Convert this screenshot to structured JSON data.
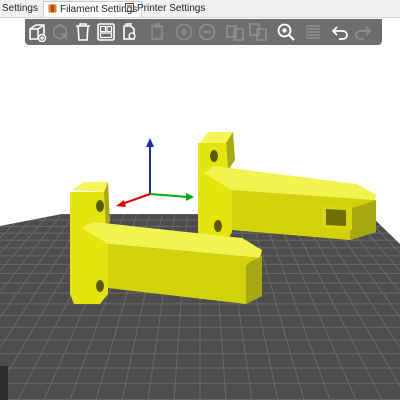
{
  "tabs": [
    {
      "label": "Print Settings",
      "icon": "gear-icon"
    },
    {
      "label": "Filament Settings",
      "icon": "filament-spool-icon"
    },
    {
      "label": "Printer Settings",
      "icon": "printer-icon"
    }
  ],
  "toolbar": {
    "buttons": [
      {
        "name": "add-object",
        "icon": "add-cube-icon",
        "enabled": true
      },
      {
        "name": "delete",
        "icon": "delete-icon",
        "enabled": false
      },
      {
        "name": "delete-all",
        "icon": "trash-icon",
        "enabled": true
      },
      {
        "name": "arrange",
        "icon": "arrange-icon",
        "enabled": true
      },
      {
        "name": "copy",
        "icon": "copy-icon",
        "enabled": true
      },
      {
        "name": "paste",
        "icon": "paste-icon",
        "enabled": false
      },
      {
        "name": "add-instance",
        "icon": "plus-circle-icon",
        "enabled": false
      },
      {
        "name": "remove-instance",
        "icon": "minus-circle-icon",
        "enabled": false
      },
      {
        "name": "split-objects",
        "icon": "split-objects-icon",
        "enabled": false
      },
      {
        "name": "split-parts",
        "icon": "split-parts-icon",
        "enabled": false
      },
      {
        "name": "search",
        "icon": "search-icon",
        "enabled": true
      },
      {
        "name": "layers",
        "icon": "layers-icon",
        "enabled": false
      },
      {
        "name": "undo",
        "icon": "undo-icon",
        "enabled": true
      },
      {
        "name": "redo",
        "icon": "redo-icon",
        "enabled": false
      }
    ]
  },
  "scene": {
    "object_color": "#e4e40f",
    "bed_color": "#4d4d4d",
    "grid_color": "#6a6a6a",
    "background_color": "#ffffff",
    "axis_colors": {
      "x": "#e00000",
      "y": "#00b000",
      "z": "#1a2ab8"
    },
    "objects": [
      "bracket-left",
      "bracket-right"
    ]
  }
}
